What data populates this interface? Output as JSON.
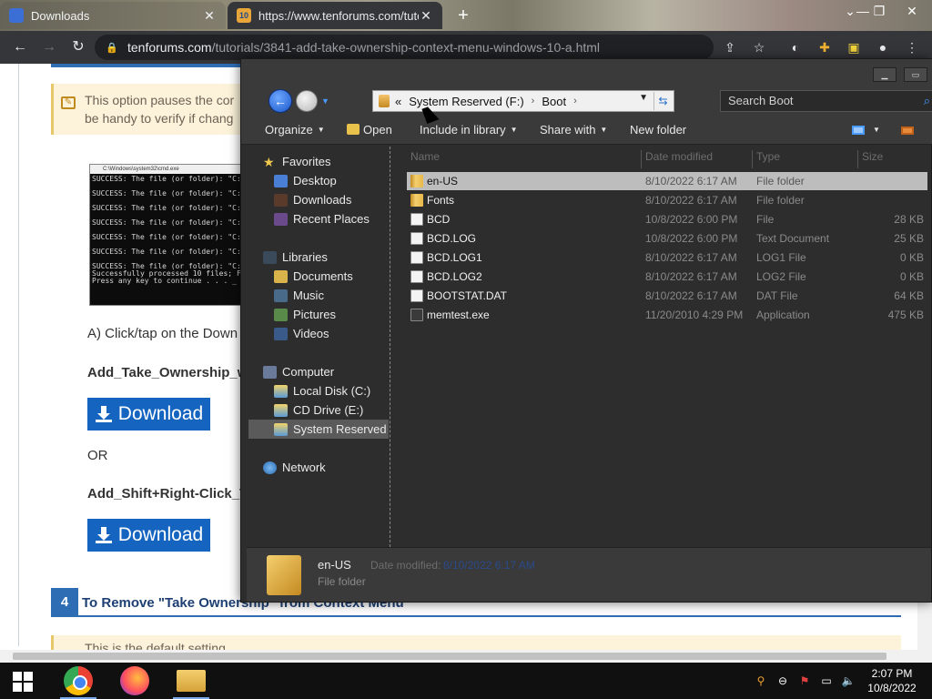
{
  "browser": {
    "tabs": [
      {
        "title": "Downloads",
        "active": false
      },
      {
        "title": "https://www.tenforums.com/tutc",
        "active": true
      }
    ],
    "url_host": "tenforums.com",
    "url_path": "/tutorials/3841-add-take-ownership-context-menu-windows-10-a.html"
  },
  "webpage": {
    "note_line1": "This option pauses the cor",
    "note_line2": "be handy to verify if chang",
    "cmd_title": "C:\\Windows\\system32\\cmd.exe",
    "cmd_lines": [
      "SUCCESS: The file (or folder): \"C:",
      "SUCCESS: The file (or folder): \"C:",
      "SUCCESS: The file (or folder): \"C:",
      "SUCCESS: The file (or folder): \"C:",
      "SUCCESS: The file (or folder): \"C:",
      "SUCCESS: The file (or folder): \"C:",
      "SUCCESS: The file (or folder): \"C:",
      "Successfully processed 10 files; F",
      "Press any key to continue . . . _"
    ],
    "step_a_text": "A) Click/tap on the Down",
    "file1_name": "Add_Take_Ownership_w",
    "download_label": "Download",
    "or_text": "OR",
    "file2_name": "Add_Shift+Right-Click_T",
    "step_number": "4",
    "step_title": "To Remove \"Take Ownership\" from Context Menu",
    "bottom_note": "This is the default setting."
  },
  "explorer": {
    "breadcrumb": {
      "overflow": "«",
      "items": [
        "System Reserved (F:)",
        "Boot"
      ]
    },
    "search_placeholder": "Search Boot",
    "commands": {
      "organize": "Organize",
      "open": "Open",
      "include_in_library": "Include in library",
      "share_with": "Share with",
      "new_folder": "New folder"
    },
    "nav": {
      "favorites_header": "Favorites",
      "favorites": [
        "Desktop",
        "Downloads",
        "Recent Places"
      ],
      "libraries_header": "Libraries",
      "libraries": [
        "Documents",
        "Music",
        "Pictures",
        "Videos"
      ],
      "computer_header": "Computer",
      "drives": [
        "Local Disk (C:)",
        "CD Drive (E:)",
        "System Reserved (F:)"
      ],
      "network_header": "Network"
    },
    "columns": [
      "Name",
      "Date modified",
      "Type",
      "Size"
    ],
    "files": [
      {
        "name": "en-US",
        "date": "8/10/2022 6:17 AM",
        "type": "File folder",
        "size": "",
        "kind": "folder",
        "selected": true
      },
      {
        "name": "Fonts",
        "date": "8/10/2022 6:17 AM",
        "type": "File folder",
        "size": "",
        "kind": "folder",
        "selected": false
      },
      {
        "name": "BCD",
        "date": "10/8/2022 6:00 PM",
        "type": "File",
        "size": "28 KB",
        "kind": "file",
        "selected": false
      },
      {
        "name": "BCD.LOG",
        "date": "10/8/2022 6:00 PM",
        "type": "Text Document",
        "size": "25 KB",
        "kind": "file",
        "selected": false
      },
      {
        "name": "BCD.LOG1",
        "date": "8/10/2022 6:17 AM",
        "type": "LOG1 File",
        "size": "0 KB",
        "kind": "file",
        "selected": false
      },
      {
        "name": "BCD.LOG2",
        "date": "8/10/2022 6:17 AM",
        "type": "LOG2 File",
        "size": "0 KB",
        "kind": "file",
        "selected": false
      },
      {
        "name": "BOOTSTAT.DAT",
        "date": "8/10/2022 6:17 AM",
        "type": "DAT File",
        "size": "64 KB",
        "kind": "file",
        "selected": false
      },
      {
        "name": "memtest.exe",
        "date": "11/20/2010 4:29 PM",
        "type": "Application",
        "size": "475 KB",
        "kind": "app",
        "selected": false
      }
    ],
    "details": {
      "name": "en-US",
      "type": "File folder",
      "date_label": "Date modified:",
      "date_value": "8/10/2022 6:17 AM"
    }
  },
  "taskbar": {
    "time": "2:07 PM",
    "date": "10/8/2022"
  }
}
